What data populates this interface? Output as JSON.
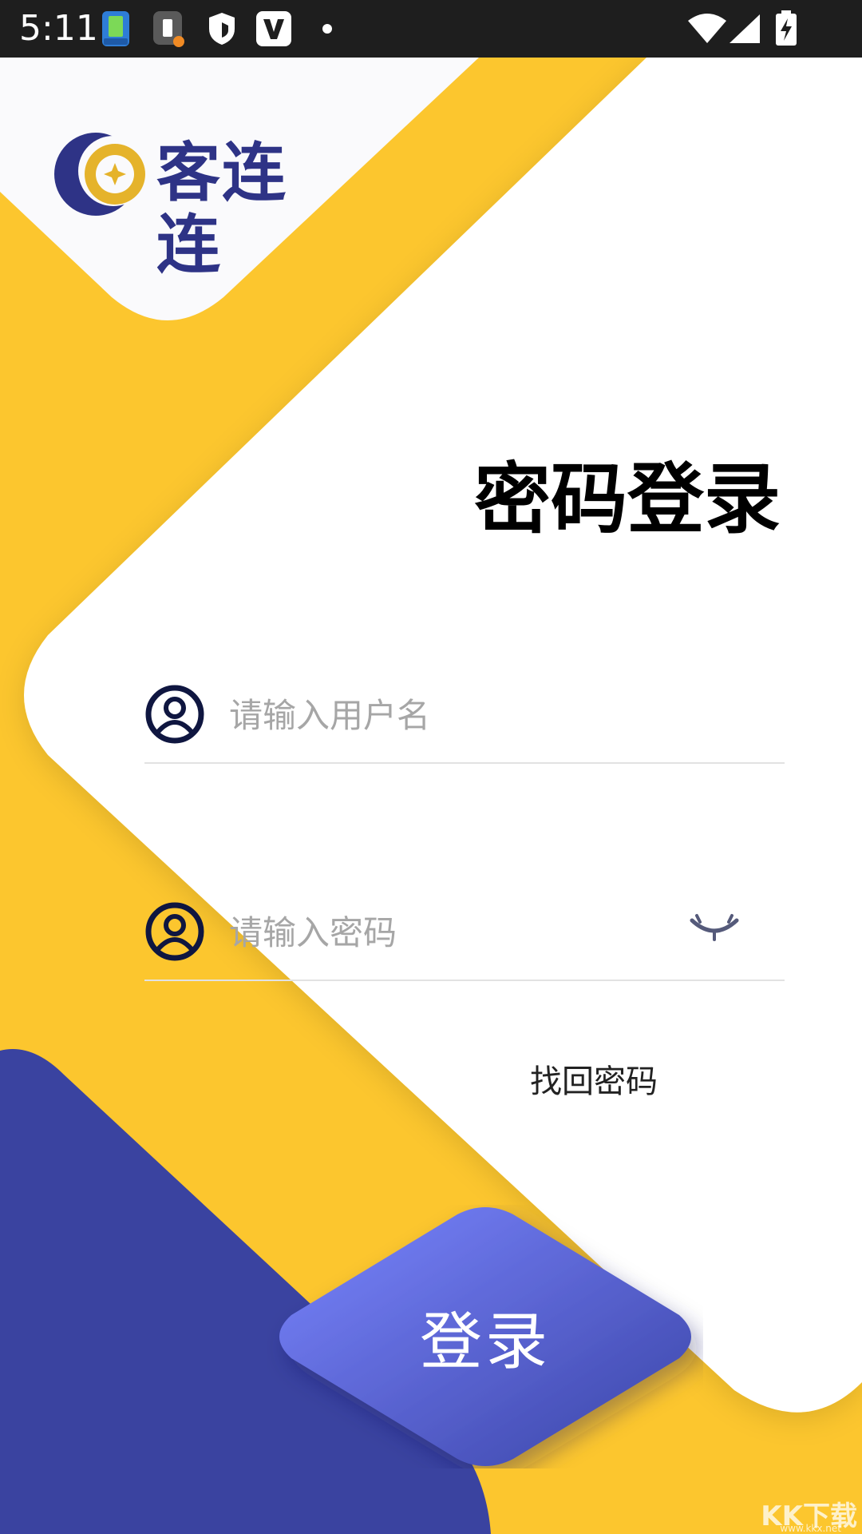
{
  "status_bar": {
    "time": "5:11"
  },
  "logo": {
    "text": "客连连"
  },
  "login": {
    "title": "密码登录",
    "username_placeholder": "请输入用户名",
    "password_placeholder": "请输入密码",
    "forgot_password": "找回密码",
    "submit_label": "登录"
  },
  "watermark": {
    "text": "KK下载",
    "sub": "www.kkx.net"
  },
  "colors": {
    "yellow": "#FCC62E",
    "navy": "#2E3386",
    "button_start": "#7B86FF",
    "button_end": "#3A43A6",
    "blue_bg": "#3A43A0"
  }
}
